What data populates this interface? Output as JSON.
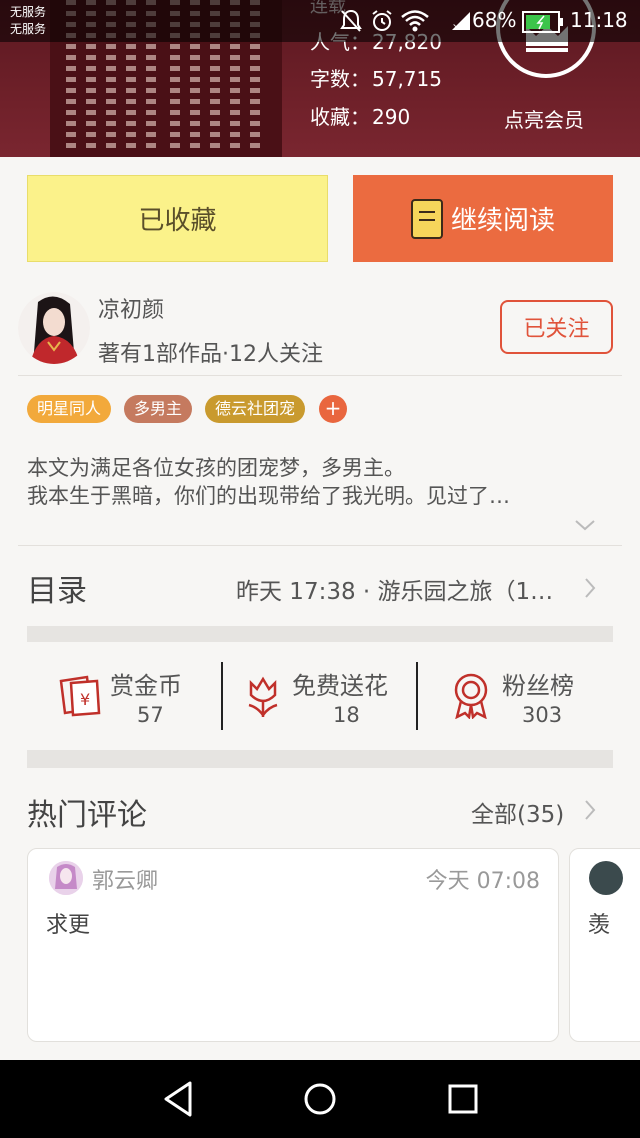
{
  "status_bar": {
    "carrier_line1": "无服务",
    "carrier_line2": "无服务",
    "battery": "68%",
    "time": "11:18"
  },
  "header": {
    "status_word": "连载",
    "popularity_label": "人气：",
    "popularity_value": "27,820",
    "words_label": "字数：",
    "words_value": "57,715",
    "favorites_label": "收藏：",
    "favorites_value": "290",
    "vip_label": "点亮会员"
  },
  "actions": {
    "favorited_label": "已收藏",
    "continue_label": "继续阅读"
  },
  "author": {
    "name": "凉初颜",
    "meta": "著有1部作品·12人关注",
    "follow_label": "已关注"
  },
  "tags": [
    {
      "label": "明星同人",
      "color": "#f2a93b"
    },
    {
      "label": "多男主",
      "color": "#c57a5f"
    },
    {
      "label": "德云社团宠",
      "color": "#c99a2e"
    }
  ],
  "tag_plus": "+",
  "description": {
    "line1": "本文为满足各位女孩的团宠梦，多男主。",
    "line2": "我本生于黑暗，你们的出现带给了我光明。见过了…"
  },
  "catalog": {
    "label": "目录",
    "latest": "昨天 17:38 · 游乐园之旅（1…"
  },
  "rewards": [
    {
      "title": "赏金币",
      "count": "57",
      "icon": "red-envelope-icon"
    },
    {
      "title": "免费送花",
      "count": "18",
      "icon": "flower-icon"
    },
    {
      "title": "粉丝榜",
      "count": "303",
      "icon": "medal-icon"
    }
  ],
  "comments": {
    "title": "热门评论",
    "all_label": "全部(35)",
    "items": [
      {
        "user": "郭云卿",
        "time": "今天 07:08",
        "text": "求更"
      },
      {
        "user": "",
        "time": "",
        "text": "羡"
      }
    ]
  },
  "colors": {
    "accent": "#eb6b40",
    "favorited_bg": "#fbf28a",
    "follow": "#e0533a",
    "header_bg": "#6e2029"
  }
}
